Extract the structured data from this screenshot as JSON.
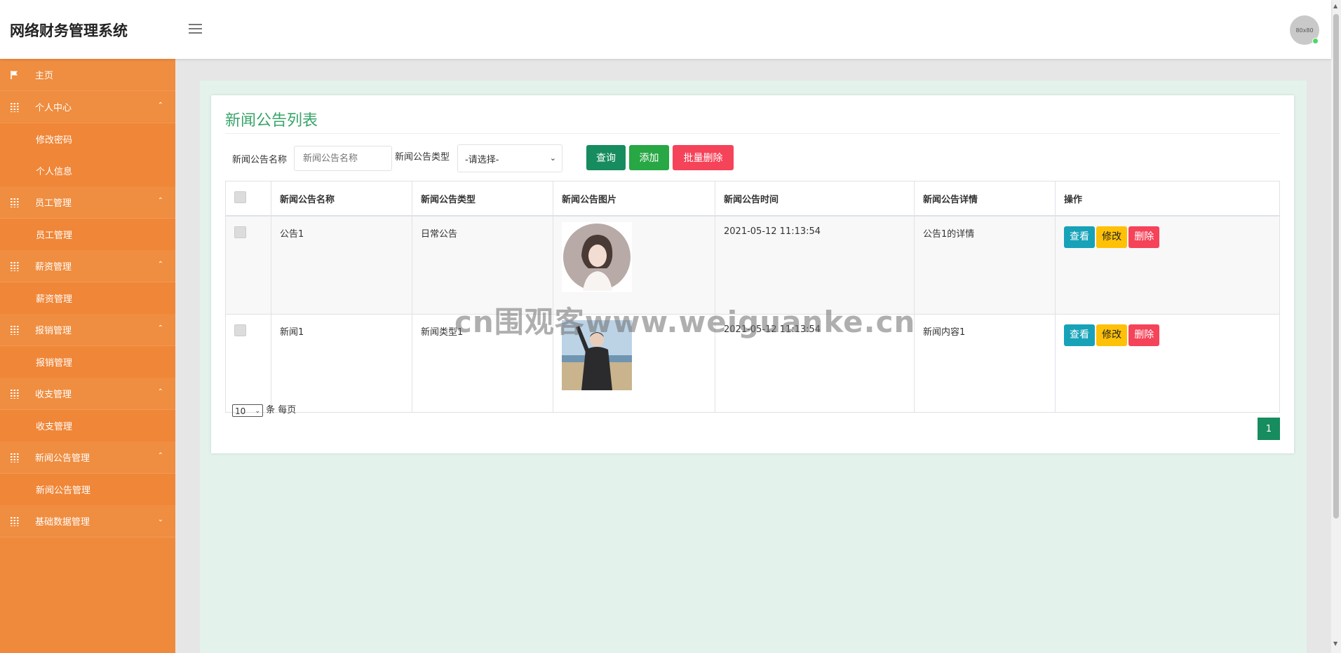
{
  "app": {
    "title": "网络财务管理系统",
    "avatar_text": "80x80"
  },
  "sidebar": {
    "items": [
      {
        "type": "top",
        "label": "主页",
        "icon": "flag-icon"
      },
      {
        "type": "top",
        "label": "个人中心",
        "icon": "grid-icon",
        "chevron": "⌃"
      },
      {
        "type": "sub",
        "label": "修改密码"
      },
      {
        "type": "sub",
        "label": "个人信息"
      },
      {
        "type": "top",
        "label": "员工管理",
        "icon": "grid-icon",
        "chevron": "⌃"
      },
      {
        "type": "sub",
        "label": "员工管理"
      },
      {
        "type": "top",
        "label": "薪资管理",
        "icon": "grid-icon",
        "chevron": "⌃"
      },
      {
        "type": "sub",
        "label": "薪资管理"
      },
      {
        "type": "top",
        "label": "报销管理",
        "icon": "grid-icon",
        "chevron": "⌃"
      },
      {
        "type": "sub",
        "label": "报销管理"
      },
      {
        "type": "top",
        "label": "收支管理",
        "icon": "grid-icon",
        "chevron": "⌃"
      },
      {
        "type": "sub",
        "label": "收支管理"
      },
      {
        "type": "top",
        "label": "新闻公告管理",
        "icon": "grid-icon",
        "chevron": "⌃"
      },
      {
        "type": "sub",
        "label": "新闻公告管理"
      },
      {
        "type": "top",
        "label": "基础数据管理",
        "icon": "grid-icon",
        "chevron": "⌄"
      }
    ]
  },
  "page": {
    "title": "新闻公告列表",
    "search": {
      "name_label": "新闻公告名称",
      "name_placeholder": "新闻公告名称",
      "type_label": "新闻公告类型",
      "type_value": "-请选择-",
      "query_label": "查询",
      "add_label": "添加",
      "batch_delete_label": "批量删除"
    },
    "table": {
      "headers": [
        "新闻公告名称",
        "新闻公告类型",
        "新闻公告图片",
        "新闻公告时间",
        "新闻公告详情",
        "操作"
      ],
      "rows": [
        {
          "name": "公告1",
          "type": "日常公告",
          "time": "2021-05-12 11:13:54",
          "detail": "公告1的详情"
        },
        {
          "name": "新闻1",
          "type": "新闻类型1",
          "time": "2021-05-12 11:13:54",
          "detail": "新闻内容1"
        }
      ],
      "actions": {
        "view": "查看",
        "edit": "修改",
        "delete": "删除"
      }
    },
    "pagination": {
      "page_size": "10",
      "page_size_suffix": "条 每页",
      "current_page": "1"
    }
  },
  "watermark": "cn围观客www.weiguanke.cn",
  "colors": {
    "sidebar": "#ef8a3c",
    "accent_green": "#38a46a",
    "btn_query": "#178c5e",
    "btn_add": "#28a745",
    "btn_delete": "#f54359",
    "btn_view": "#17a2b8",
    "btn_edit": "#ffc107"
  }
}
